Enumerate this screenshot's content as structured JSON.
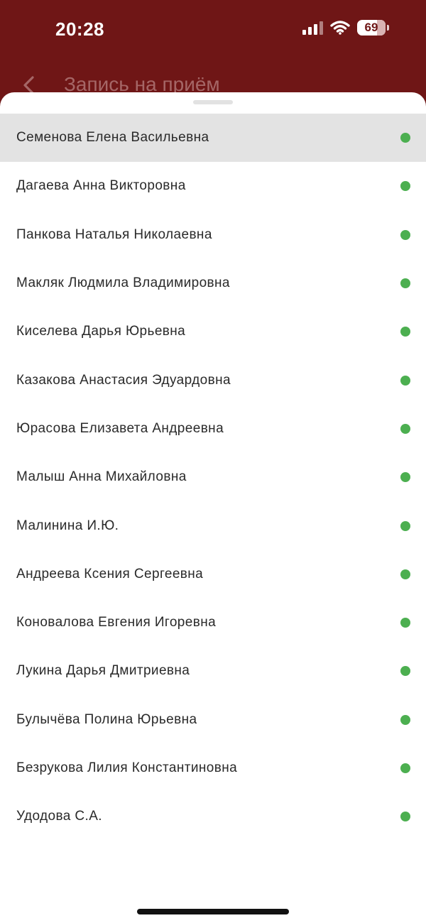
{
  "status_bar": {
    "time": "20:28",
    "battery": "69",
    "battery_level": 0.69
  },
  "header": {
    "title": "Запись на приём"
  },
  "colors": {
    "header_bg": "#6f1616",
    "available": "#4caf50",
    "selected_row": "#e3e3e3"
  },
  "doctors": [
    {
      "name": "Семенова Елена Васильевна",
      "available": true
    },
    {
      "name": "Дагаева Анна Викторовна",
      "available": true
    },
    {
      "name": "Панкова Наталья Николаевна",
      "available": true
    },
    {
      "name": "Макляк Людмила Владимировна",
      "available": true
    },
    {
      "name": "Киселева Дарья Юрьевна",
      "available": true
    },
    {
      "name": "Казакова Анастасия Эдуардовна",
      "available": true
    },
    {
      "name": "Юрасова Елизавета Андреевна",
      "available": true
    },
    {
      "name": "Малыш Анна Михайловна",
      "available": true
    },
    {
      "name": "Малинина И.Ю.",
      "available": true
    },
    {
      "name": "Андреева Ксения Сергеевна",
      "available": true
    },
    {
      "name": "Коновалова Евгения Игоревна",
      "available": true
    },
    {
      "name": "Лукина Дарья Дмитриевна",
      "available": true
    },
    {
      "name": "Булычёва Полина Юрьевна",
      "available": true
    },
    {
      "name": "Безрукова Лилия Константиновна",
      "available": true
    },
    {
      "name": "Удодова С.А.",
      "available": true
    }
  ],
  "selected_index": 0
}
